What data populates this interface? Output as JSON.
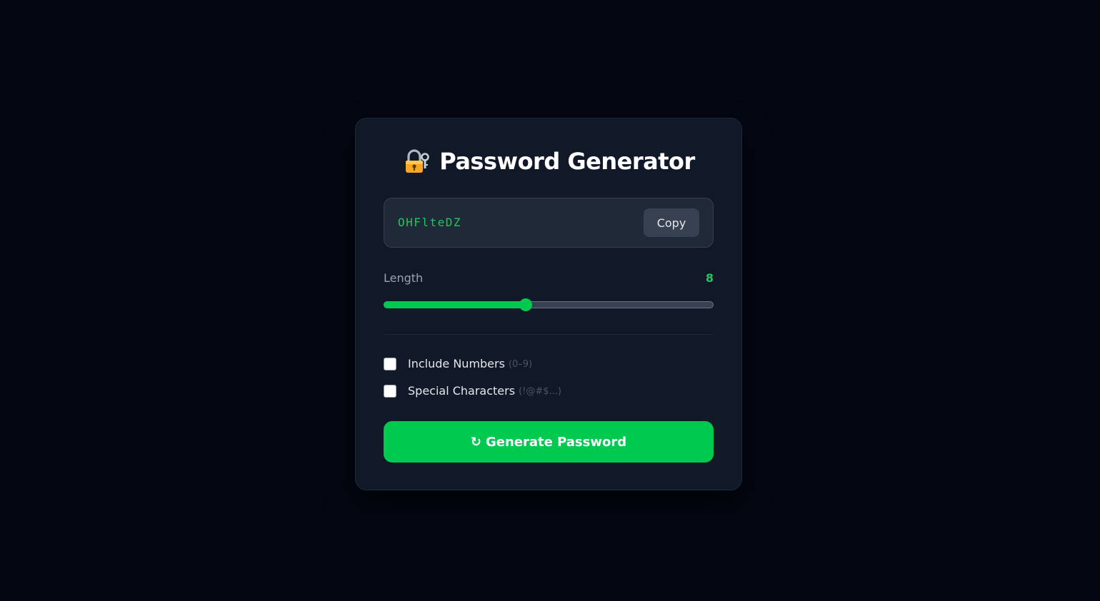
{
  "header": {
    "title": "Password Generator",
    "icon": "locked-with-key-icon"
  },
  "password": {
    "value": "OHFlteDZ",
    "copy_label": "Copy"
  },
  "length": {
    "label": "Length",
    "value": "8",
    "slider_fraction": 0.43
  },
  "options": [
    {
      "label": "Include Numbers",
      "hint": "(0–9)",
      "checked": false
    },
    {
      "label": "Special Characters",
      "hint": "(!@#$...)",
      "checked": false
    }
  ],
  "generate": {
    "icon": "↻",
    "label": "Generate Password"
  },
  "colors": {
    "background": "#030712",
    "card": "#111827",
    "accent": "#00c950",
    "password_text": "#22c55e"
  }
}
